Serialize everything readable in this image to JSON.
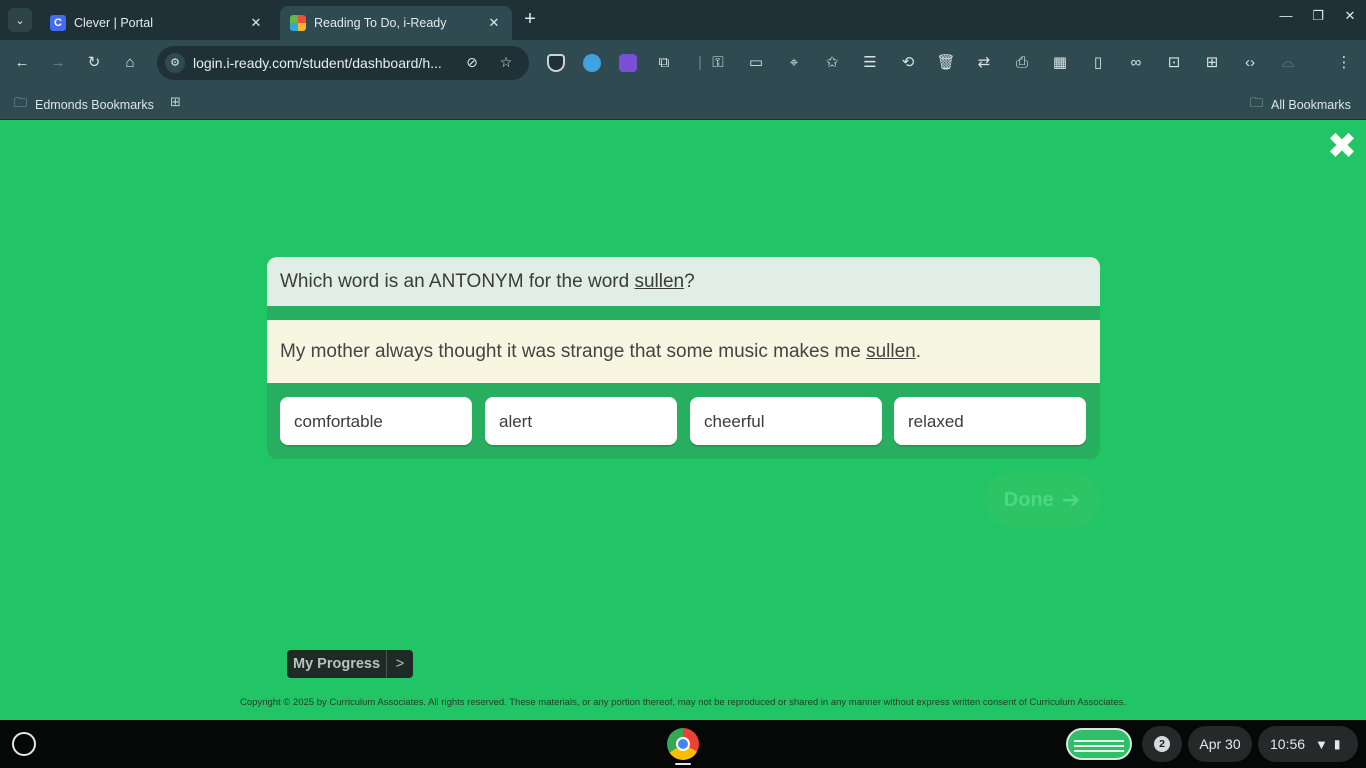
{
  "browser": {
    "tabs": [
      {
        "title": "Clever | Portal",
        "favicon": "C"
      },
      {
        "title": "Reading To Do, i-Ready"
      }
    ],
    "url": "login.i-ready.com/student/dashboard/h...",
    "bookmarks": {
      "folder": "Edmonds Bookmarks",
      "all": "All Bookmarks"
    }
  },
  "lesson": {
    "question": {
      "prefix": "Which word is an ANTONYM for the word ",
      "word": "sullen",
      "suffix": "?"
    },
    "passage": {
      "prefix": "My mother always thought it was strange that some music makes me ",
      "word": "sullen",
      "suffix": "."
    },
    "choices": [
      "comfortable",
      "alert",
      "cheerful",
      "relaxed"
    ],
    "done_label": "Done",
    "done_arrow": "➔",
    "progress_label": "My Progress",
    "progress_chevron": ">",
    "copyright": "Copyright © 2025 by Curriculum Associates. All rights reserved. These materials, or any portion thereof, may not be reproduced or shared in any manner without express written consent of Curriculum Associates."
  },
  "shelf": {
    "notification_count": "2",
    "date": "Apr 30",
    "time": "10:56"
  },
  "colors": {
    "page_bg": "#22c565",
    "card_bg": "#27ae5f",
    "question_bg": "#e1eee6",
    "passage_bg": "#f7f6e1",
    "chrome_frame": "#1f3136",
    "chrome_toolbar": "#2f4a50"
  }
}
